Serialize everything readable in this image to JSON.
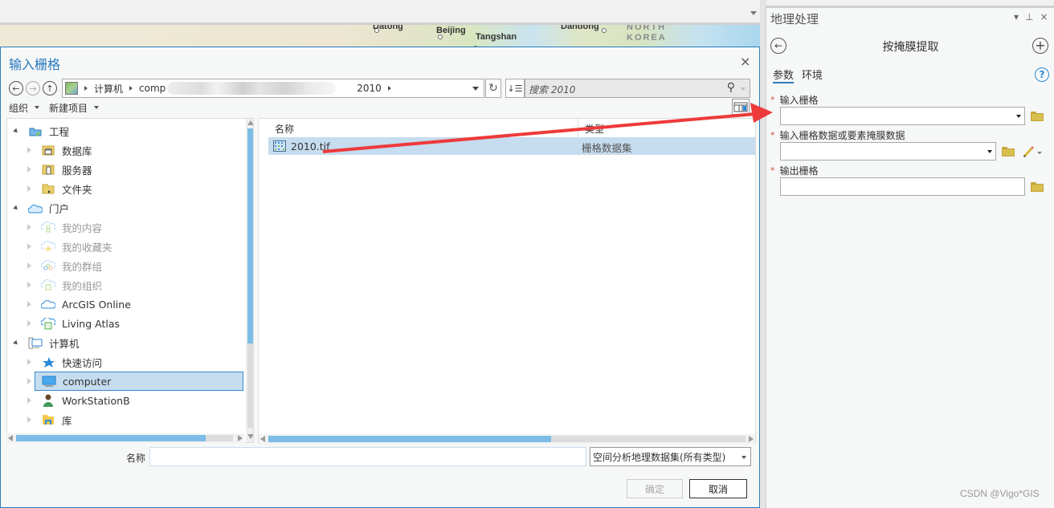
{
  "map": {
    "labels": [
      "Datong",
      "Beijing",
      "Tangshan",
      "Dandong",
      "NORTH",
      "KOREA"
    ]
  },
  "dialog": {
    "title": "输入栅格",
    "close_icon": "×",
    "nav": {
      "back_icon": "←",
      "forward_icon": "→",
      "up_icon": "↑"
    },
    "address": {
      "segments": [
        "计算机",
        "comp",
        "2010"
      ]
    },
    "refresh_icon": "↻",
    "sort_icon": "↓☰",
    "search": {
      "placeholder": "搜索 2010",
      "icon": "⚲"
    },
    "toolbar": {
      "organize": "组织",
      "new_item": "新建项目"
    },
    "tree": [
      {
        "label": "工程",
        "level": 0,
        "expanded": true,
        "icon": "project-folder-icon",
        "muted": false
      },
      {
        "label": "数据库",
        "level": 1,
        "expanded": false,
        "icon": "database-folder-icon",
        "muted": false
      },
      {
        "label": "服务器",
        "level": 1,
        "expanded": false,
        "icon": "server-folder-icon",
        "muted": false
      },
      {
        "label": "文件夹",
        "level": 1,
        "expanded": false,
        "icon": "folder-icon",
        "muted": false
      },
      {
        "label": "门户",
        "level": 0,
        "expanded": true,
        "icon": "portal-cloud-icon",
        "muted": false
      },
      {
        "label": "我的内容",
        "level": 1,
        "expanded": false,
        "icon": "my-content-icon",
        "muted": true
      },
      {
        "label": "我的收藏夹",
        "level": 1,
        "expanded": false,
        "icon": "favorites-icon",
        "muted": true
      },
      {
        "label": "我的群组",
        "level": 1,
        "expanded": false,
        "icon": "groups-icon",
        "muted": true
      },
      {
        "label": "我的组织",
        "level": 1,
        "expanded": false,
        "icon": "organization-icon",
        "muted": true
      },
      {
        "label": "ArcGIS Online",
        "level": 1,
        "expanded": false,
        "icon": "cloud-icon",
        "muted": false
      },
      {
        "label": "Living Atlas",
        "level": 1,
        "expanded": false,
        "icon": "living-atlas-icon",
        "muted": false
      },
      {
        "label": "计算机",
        "level": 0,
        "expanded": true,
        "icon": "computer-icon",
        "muted": false
      },
      {
        "label": "快速访问",
        "level": 1,
        "expanded": false,
        "icon": "quick-access-star-icon",
        "muted": false
      },
      {
        "label": "computer",
        "level": 1,
        "expanded": false,
        "icon": "monitor-icon",
        "muted": false,
        "selected": true
      },
      {
        "label": "WorkStationB",
        "level": 1,
        "expanded": false,
        "icon": "user-icon",
        "muted": false
      },
      {
        "label": "库",
        "level": 1,
        "expanded": false,
        "icon": "library-folder-icon",
        "muted": false
      }
    ],
    "file_list": {
      "columns": [
        "名称",
        "类型"
      ],
      "rows": [
        {
          "name": "2010.tif",
          "type": "栅格数据集",
          "selected": true
        }
      ]
    },
    "name_label": "名称",
    "name_value": "",
    "filter": "空间分析地理数据集(所有类型)",
    "ok_label": "确定",
    "cancel_label": "取消"
  },
  "geoprocessing": {
    "pane_title": "地理处理",
    "pane_controls": {
      "menu": "▾",
      "pin": "⊥",
      "close": "×"
    },
    "tool_title": "按掩膜提取",
    "tabs": [
      "参数",
      "环境"
    ],
    "help_icon": "?",
    "parameters": [
      {
        "label": "输入栅格",
        "required": true,
        "value": "",
        "has_dropdown": true
      },
      {
        "label": "输入栅格数据或要素掩膜数据",
        "required": true,
        "value": "",
        "has_dropdown": true,
        "has_edit": true
      },
      {
        "label": "输出栅格",
        "required": true,
        "value": "",
        "has_dropdown": false
      }
    ],
    "required_marker": "*"
  },
  "watermark": "CSDN @Vigo*GIS",
  "colors": {
    "accent": "#2979c0",
    "selection": "#c6dcef",
    "scroll_thumb": "#7bbde6",
    "annotation_arrow": "#ee3a3a",
    "required": "#d0553a"
  }
}
